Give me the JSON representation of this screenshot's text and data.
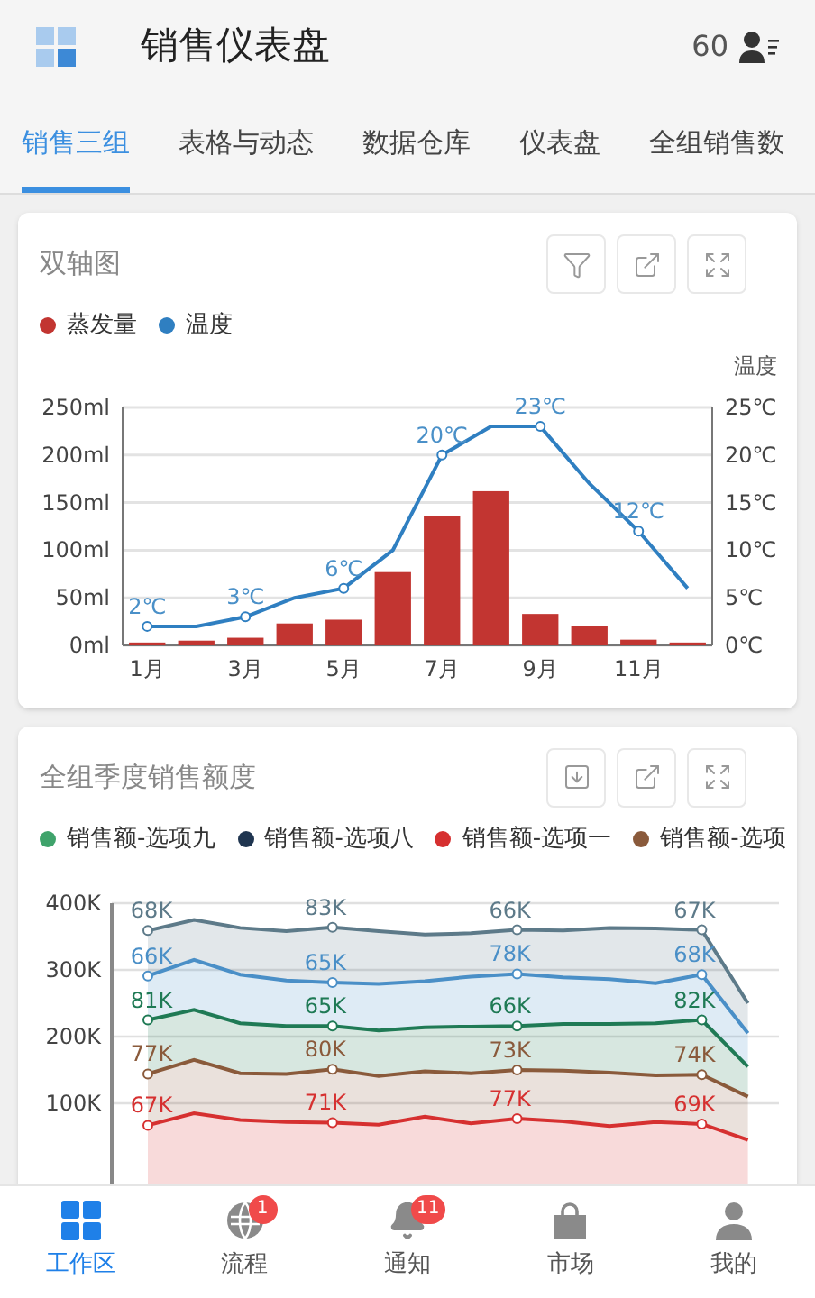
{
  "header": {
    "title": "销售仪表盘",
    "count": "60"
  },
  "tabs": [
    {
      "label": "销售三组",
      "selected": true
    },
    {
      "label": "表格与动态",
      "selected": false
    },
    {
      "label": "数据仓库",
      "selected": false
    },
    {
      "label": "仪表盘",
      "selected": false
    },
    {
      "label": "全组销售数",
      "selected": false
    }
  ],
  "cards": [
    {
      "title": "双轴图",
      "actions": [
        {
          "kind": "filter"
        },
        {
          "kind": "share"
        },
        {
          "kind": "expand"
        }
      ],
      "charts": [
        {
          "chart_data": {
            "type": "bar",
            "grid": true,
            "x": [
              1,
              2,
              3,
              4,
              5,
              6,
              7,
              8,
              9,
              10,
              11,
              12
            ],
            "xlim": [
              0.5,
              12.5
            ],
            "xticks": [
              {
                "value": 1,
                "label": "1月"
              },
              {
                "value": 3,
                "label": "3月"
              },
              {
                "value": 5,
                "label": "5月"
              },
              {
                "value": 7,
                "label": "7月"
              },
              {
                "value": 9,
                "label": "9月"
              },
              {
                "value": 11,
                "label": "11月"
              }
            ],
            "ylim": [
              0,
              250
            ],
            "yticks": [
              {
                "value": 0,
                "label": "0ml"
              },
              {
                "value": 50,
                "label": "50ml"
              },
              {
                "value": 100,
                "label": "100ml"
              },
              {
                "value": 150,
                "label": "150ml"
              },
              {
                "value": 200,
                "label": "200ml"
              },
              {
                "value": 250,
                "label": "250ml"
              }
            ],
            "series": [
              {
                "name": "蒸发量",
                "color": "#c23531",
                "values": [
                  3,
                  5,
                  8,
                  23,
                  27,
                  77,
                  136,
                  162,
                  33,
                  20,
                  6,
                  3
                ]
              }
            ]
          }
        },
        {
          "chart_data": {
            "type": "line",
            "x": [
              1,
              2,
              3,
              4,
              5,
              6,
              7,
              8,
              9,
              10,
              11,
              12
            ],
            "xlim": [
              0.5,
              12.5
            ],
            "ylabel": "温度",
            "ylim": [
              0,
              25
            ],
            "yticks": [
              {
                "value": 0,
                "label": "0℃"
              },
              {
                "value": 5,
                "label": "5℃"
              },
              {
                "value": 10,
                "label": "10℃"
              },
              {
                "value": 15,
                "label": "15℃"
              },
              {
                "value": 20,
                "label": "20℃"
              },
              {
                "value": 25,
                "label": "25℃"
              }
            ],
            "series": [
              {
                "name": "温度",
                "color": "#2f7fc1",
                "values": [
                  2,
                  2,
                  3,
                  5,
                  6,
                  10,
                  20,
                  23,
                  23,
                  17,
                  12,
                  6
                ],
                "value_labels": [
                  "2℃",
                  null,
                  "3℃",
                  null,
                  "6℃",
                  null,
                  "20℃",
                  null,
                  "23℃",
                  null,
                  "12℃",
                  null
                ]
              }
            ]
          }
        }
      ]
    },
    {
      "title": "全组季度销售额度",
      "actions": [
        {
          "kind": "download"
        },
        {
          "kind": "share"
        },
        {
          "kind": "expand"
        }
      ],
      "legend": [
        {
          "label": "销售额-选项九",
          "color": "#3fa36b"
        },
        {
          "label": "销售额-选项八",
          "color": "#1f3550"
        },
        {
          "label": "销售额-选项一",
          "color": "#d63030"
        },
        {
          "label": "销售额-选项",
          "color": "#8a5a3b"
        }
      ],
      "chart_data": {
        "type": "area",
        "stacked": true,
        "grid": true,
        "ylim": [
          0,
          400
        ],
        "yticks": [
          {
            "value": 100,
            "label": "100K"
          },
          {
            "value": 200,
            "label": "200K"
          },
          {
            "value": 300,
            "label": "300K"
          },
          {
            "value": 400,
            "label": "400K"
          }
        ],
        "series": [
          {
            "color": "#d63030",
            "values": [
              67,
              85,
              75,
              72,
              71,
              68,
              80,
              70,
              77,
              73,
              66,
              72,
              69,
              45
            ],
            "value_labels": [
              "67K",
              null,
              null,
              null,
              "71K",
              null,
              null,
              null,
              "77K",
              null,
              null,
              null,
              "69K",
              null
            ]
          },
          {
            "color": "#8a5a3b",
            "values": [
              77,
              80,
              70,
              72,
              80,
              73,
              68,
              75,
              73,
              76,
              80,
              70,
              74,
              65
            ],
            "value_labels": [
              "77K",
              null,
              null,
              null,
              "80K",
              null,
              null,
              null,
              "73K",
              null,
              null,
              null,
              "74K",
              null
            ]
          },
          {
            "color": "#1f7a55",
            "values": [
              81,
              75,
              75,
              72,
              65,
              68,
              66,
              70,
              66,
              70,
              73,
              78,
              82,
              45
            ],
            "value_labels": [
              "81K",
              null,
              null,
              null,
              "65K",
              null,
              null,
              null,
              "66K",
              null,
              null,
              null,
              "82K",
              null
            ]
          },
          {
            "color": "#4a8fc7",
            "values": [
              66,
              75,
              73,
              68,
              65,
              70,
              69,
              75,
              78,
              70,
              67,
              60,
              68,
              50
            ],
            "value_labels": [
              "66K",
              null,
              null,
              null,
              "65K",
              null,
              null,
              null,
              "78K",
              null,
              null,
              null,
              "68K",
              null
            ]
          },
          {
            "color": "#5d7a89",
            "values": [
              68,
              60,
              70,
              74,
              83,
              79,
              70,
              65,
              66,
              70,
              77,
              82,
              67,
              45
            ],
            "value_labels": [
              "68K",
              null,
              null,
              null,
              "83K",
              null,
              null,
              null,
              "66K",
              null,
              null,
              null,
              "67K",
              null
            ]
          }
        ]
      }
    }
  ],
  "bottom_nav": [
    {
      "label": "工作区",
      "kind": "grid",
      "selected": true
    },
    {
      "label": "流程",
      "kind": "globe",
      "badge": "1",
      "selected": false
    },
    {
      "label": "通知",
      "kind": "bell",
      "badge": "11",
      "selected": false
    },
    {
      "label": "市场",
      "kind": "bag",
      "selected": false
    },
    {
      "label": "我的",
      "kind": "user",
      "selected": false
    }
  ]
}
